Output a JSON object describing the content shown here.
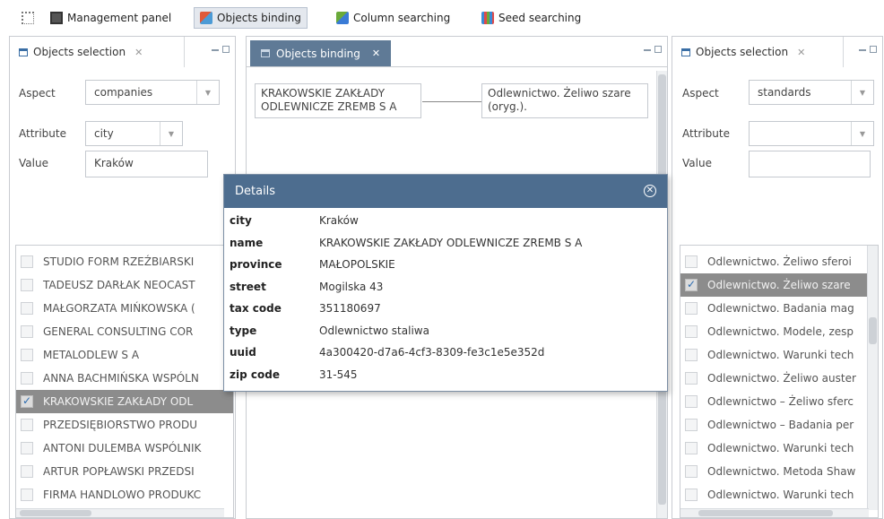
{
  "toolbar": {
    "items": [
      {
        "label": "Management panel"
      },
      {
        "label": "Objects binding"
      },
      {
        "label": "Column searching"
      },
      {
        "label": "Seed searching"
      }
    ]
  },
  "left_panel": {
    "title": "Objects selection",
    "aspect_label": "Aspect",
    "aspect_value": "companies",
    "attribute_label": "Attribute",
    "attribute_value": "city",
    "value_label": "Value",
    "value_value": "Kraków",
    "list": [
      {
        "text": "STUDIO FORM RZEŹBIARSKI",
        "checked": false
      },
      {
        "text": "TADEUSZ DARŁAK NEOCAST",
        "checked": false
      },
      {
        "text": "MAŁGORZATA MIŃKOWSKA (",
        "checked": false
      },
      {
        "text": "GENERAL CONSULTING COR",
        "checked": false
      },
      {
        "text": "METALODLEW S A",
        "checked": false
      },
      {
        "text": "ANNA BACHMIŃSKA WSPÓLN",
        "checked": false
      },
      {
        "text": "KRAKOWSKIE ZAKŁADY ODL",
        "checked": true
      },
      {
        "text": "PRZEDSIĘBIORSTWO PRODU",
        "checked": false
      },
      {
        "text": "ANTONI DULEMBA WSPÓLNIK",
        "checked": false
      },
      {
        "text": "ARTUR POPŁAWSKI PRZEDSI",
        "checked": false
      },
      {
        "text": "FIRMA HANDLOWO PRODUKC",
        "checked": false
      }
    ]
  },
  "center_panel": {
    "title": "Objects binding",
    "left_box": "KRAKOWSKIE ZAKŁADY ODLEWNICZE ZREMB S A",
    "right_box": "Odlewnictwo. Żeliwo szare (oryg.)."
  },
  "right_panel": {
    "title": "Objects selection",
    "aspect_label": "Aspect",
    "aspect_value": "standards",
    "attribute_label": "Attribute",
    "attribute_value": "",
    "value_label": "Value",
    "value_value": "",
    "list": [
      {
        "text": "Odlewnictwo. Żeliwo sferoi",
        "checked": false
      },
      {
        "text": "Odlewnictwo. Żeliwo szare",
        "checked": true
      },
      {
        "text": "Odlewnictwo. Badania mag",
        "checked": false
      },
      {
        "text": "Odlewnictwo. Modele, zesp",
        "checked": false
      },
      {
        "text": "Odlewnictwo. Warunki tech",
        "checked": false
      },
      {
        "text": "Odlewnictwo. Żeliwo auster",
        "checked": false
      },
      {
        "text": "Odlewnictwo – Żeliwo sferc",
        "checked": false
      },
      {
        "text": "Odlewnictwo – Badania per",
        "checked": false
      },
      {
        "text": "Odlewnictwo. Warunki tech",
        "checked": false
      },
      {
        "text": "Odlewnictwo. Metoda Shaw",
        "checked": false
      },
      {
        "text": "Odlewnictwo. Warunki tech",
        "checked": false
      }
    ]
  },
  "details": {
    "title": "Details",
    "rows": [
      {
        "key": "city",
        "value": "Kraków"
      },
      {
        "key": "name",
        "value": "KRAKOWSKIE ZAKŁADY ODLEWNICZE ZREMB S A"
      },
      {
        "key": "province",
        "value": "MAŁOPOLSKIE"
      },
      {
        "key": "street",
        "value": "Mogilska 43"
      },
      {
        "key": "tax code",
        "value": "351180697"
      },
      {
        "key": "type",
        "value": "Odlewnictwo staliwa"
      },
      {
        "key": "uuid",
        "value": "4a300420-d7a6-4cf3-8309-fe3c1e5e352d"
      },
      {
        "key": "zip code",
        "value": "31-545"
      }
    ]
  },
  "colors": {
    "accent": "#4d6d8f",
    "tab_active": "#5f7a96",
    "selected_row": "#8c8c8c",
    "border": "#c9ccd1"
  }
}
